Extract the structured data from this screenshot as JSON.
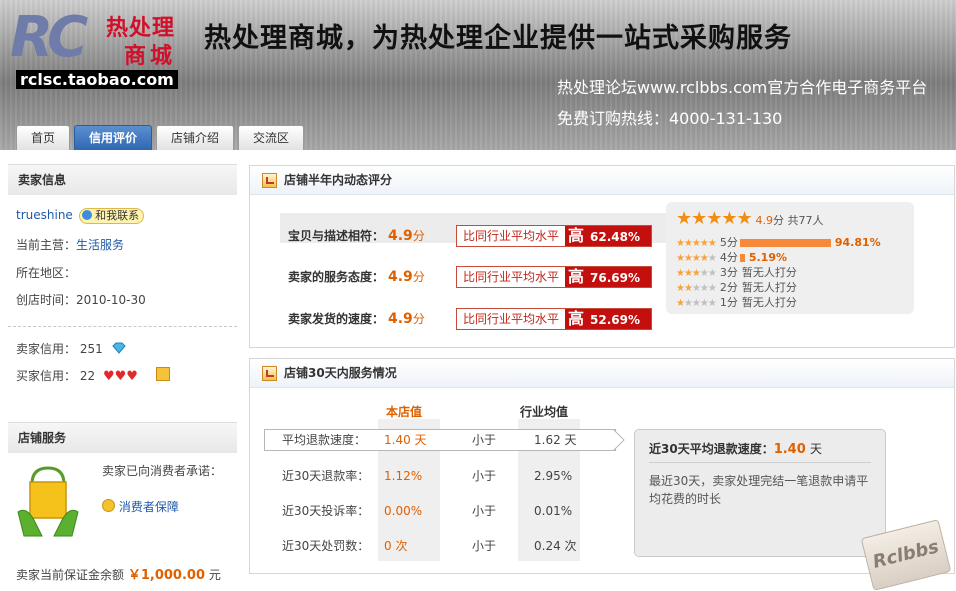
{
  "header": {
    "logo_text": "RC",
    "logo_cn_line1": "热处理",
    "logo_cn_line2": "商城",
    "logo_url": "rclsc.taobao.com",
    "slogan": "热处理商城，为热处理企业提供一站式采购服务",
    "forum_text": "热处理论坛www.rclbbs.com官方合作电子商务平台",
    "hotline_text": "免费订购热线：4000-131-130"
  },
  "tabs": [
    {
      "label": "首页",
      "active": false
    },
    {
      "label": "信用评价",
      "active": true
    },
    {
      "label": "店铺介绍",
      "active": false
    },
    {
      "label": "交流区",
      "active": false
    }
  ],
  "sidebar": {
    "seller_info_title": "卖家信息",
    "seller_name": "trueshine",
    "contact_label": "和我联系",
    "main_business_label": "当前主营：",
    "main_business_value": "生活服务",
    "region_label": "所在地区：",
    "region_value": "",
    "opened_label": "创店时间：",
    "opened_value": "2010-10-30",
    "seller_credit_label": "卖家信用：",
    "seller_credit_value": "251",
    "buyer_credit_label": "买家信用：",
    "buyer_credit_value": "22",
    "shop_service_title": "店铺服务",
    "promise_text": "卖家已向消费者承诺：",
    "protection_label": "消费者保障",
    "deposit_label": "卖家当前保证金余额",
    "deposit_value": "￥1,000.00",
    "deposit_unit": "元"
  },
  "ratings": {
    "title": "店铺半年内动态评分",
    "unit": "分",
    "compare_label": "比同行业平均水平",
    "high_label": "高",
    "rows": [
      {
        "label": "宝贝与描述相符：",
        "score": "4.9",
        "pct": "62.48%"
      },
      {
        "label": "卖家的服务态度：",
        "score": "4.9",
        "pct": "76.69%"
      },
      {
        "label": "卖家发货的速度：",
        "score": "4.9",
        "pct": "52.69%"
      }
    ],
    "summary_score": "4.9",
    "summary_text": "分 共77人",
    "distribution": [
      {
        "label": "5分",
        "value": "94.81%",
        "fraction": 0.9481,
        "stars": 5
      },
      {
        "label": "4分",
        "value": "5.19%",
        "fraction": 0.0519,
        "stars": 4
      },
      {
        "label": "3分",
        "value": "暂无人打分",
        "fraction": 0,
        "stars": 3
      },
      {
        "label": "2分",
        "value": "暂无人打分",
        "fraction": 0,
        "stars": 2
      },
      {
        "label": "1分",
        "value": "暂无人打分",
        "fraction": 0,
        "stars": 1
      }
    ]
  },
  "service": {
    "title": "店铺30天内服务情况",
    "col_store": "本店值",
    "col_industry": "行业均值",
    "rows": [
      {
        "label": "平均退款速度：",
        "store": "1.40 天",
        "cmp": "小于",
        "industry": "1.62 天"
      },
      {
        "label": "近30天退款率：",
        "store": "1.12%",
        "cmp": "小于",
        "industry": "2.95%"
      },
      {
        "label": "近30天投诉率：",
        "store": "0.00%",
        "cmp": "小于",
        "industry": "0.01%"
      },
      {
        "label": "近30天处罚数：",
        "store": "0 次",
        "cmp": "小于",
        "industry": "0.24 次"
      }
    ],
    "tip_title": "近30天平均退款速度：",
    "tip_value": "1.40",
    "tip_unit": "天",
    "tip_desc": "最近30天，卖家处理完结一笔退款申请平均花费的时长"
  },
  "watermark": "Rclbbs",
  "colors": {
    "accent_blue": "#2f67b3",
    "high_red": "#c3100e",
    "score_orange": "#e06000",
    "bar_orange": "#f7893a"
  }
}
